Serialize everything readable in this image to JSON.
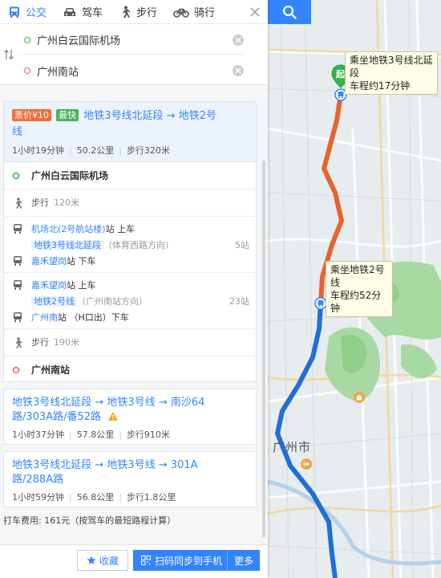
{
  "modes": [
    {
      "label": "公交",
      "icon": "bus-icon",
      "active": true
    },
    {
      "label": "驾车",
      "icon": "car-icon",
      "active": false
    },
    {
      "label": "步行",
      "icon": "walk-icon",
      "active": false
    },
    {
      "label": "骑行",
      "icon": "bike-icon",
      "active": false
    }
  ],
  "inputs": {
    "start": "广州白云国际机场",
    "end": "广州南站"
  },
  "route1": {
    "price_badge": "票价¥10",
    "fast_badge": "最快",
    "title_line1": "地铁3号线北延段 → 地铁2号",
    "title_line2": "线",
    "duration": "1小时19分钟",
    "distance": "50.2公里",
    "walk": "步行320米",
    "steps": {
      "start_place": "广州白云国际机场",
      "walk1_label": "步行",
      "walk1_dist": "120米",
      "t1_board_station": "机场北(2号航站楼)",
      "t1_board_suffix": "站 上车",
      "t1_line": "地铁3号线北延段",
      "t1_direction": "（体育西路方向）",
      "t1_stops": "5站",
      "t1_alight_station": "嘉禾望岗",
      "t1_alight_suffix": "站 下车",
      "t2_board_station": "嘉禾望岗",
      "t2_board_suffix": "站 上车",
      "t2_line": "地铁2号线",
      "t2_direction": "（广州南站方向）",
      "t2_stops": "23站",
      "t2_alight_station": "广州南",
      "t2_alight_suffix": "站 （H口出）下车",
      "walk2_label": "步行",
      "walk2_dist": "190米",
      "end_place": "广州南站"
    }
  },
  "route2": {
    "title_line1": "地铁3号线北延段 → 地铁3号线 → 南沙64",
    "title_line2": "路/303A路/番52路",
    "duration": "1小时37分钟",
    "distance": "57.8公里",
    "walk": "步行910米"
  },
  "route3": {
    "title_line1": "地铁3号线北延段 → 地铁3号线 → 301A",
    "title_line2": "路/288A路",
    "duration": "1小时59分钟",
    "distance": "56.8公里",
    "walk": "步行1.8公里"
  },
  "taxi_note": "打车费用: 161元（按驾车的最短路程计算）",
  "footer": {
    "favorite": "收藏",
    "send": "扫码同步到手机",
    "more": "更多"
  },
  "map": {
    "bubble1": "乘坐地铁3号线北延段\n车程约17分钟",
    "bubble2": "乘坐地铁2号线\n车程约52分钟",
    "start_marker": "起",
    "city": "广州市"
  },
  "colors": {
    "accent": "#3385ff",
    "metro3": "#e8622c",
    "metro2": "#1f6fd6",
    "start_green": "#35b34a",
    "end_red": "#f25b5b"
  }
}
